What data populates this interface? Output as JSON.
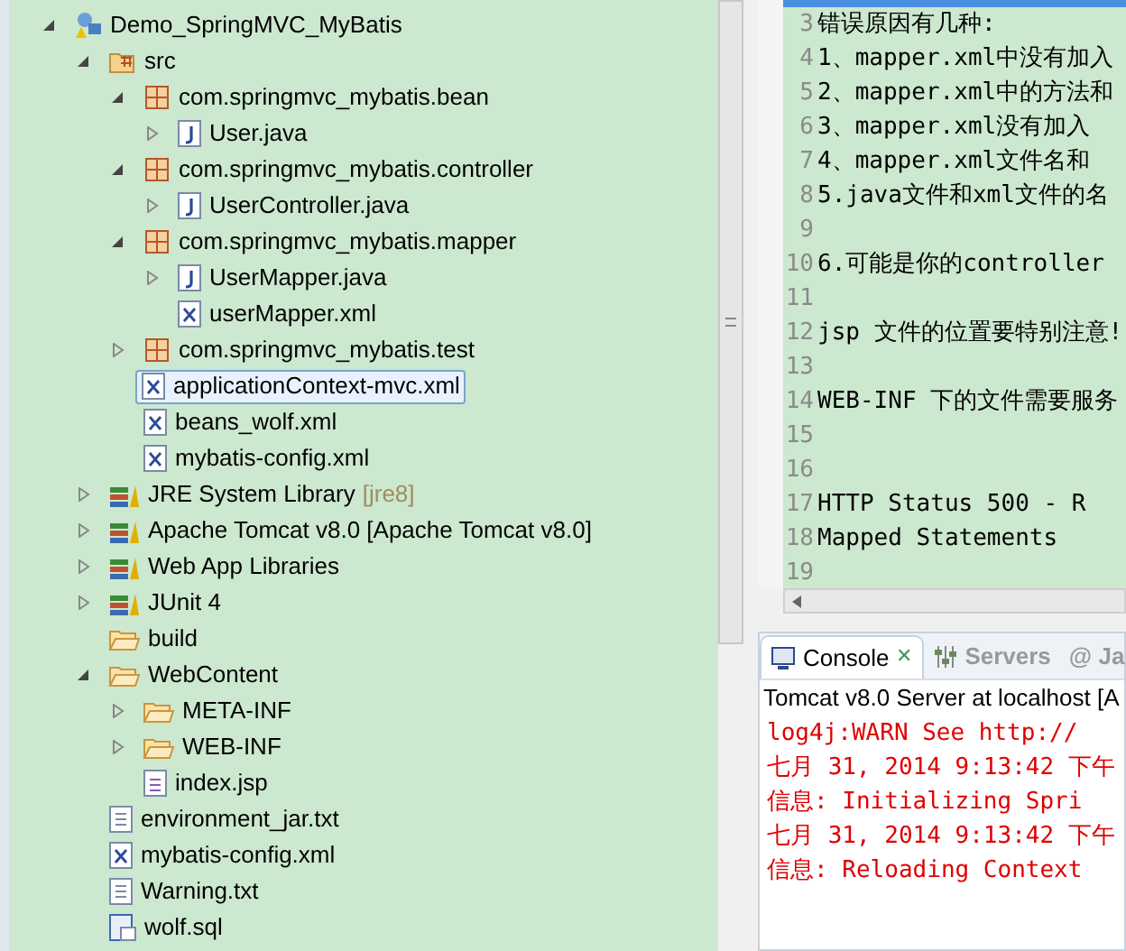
{
  "tree": [
    {
      "label": "Demo_SpringMVC_MyBatis",
      "kind": "project",
      "expanded": true,
      "selected": false,
      "children": [
        {
          "label": "src",
          "kind": "source-folder",
          "expanded": true,
          "selected": false,
          "children": [
            {
              "label": "com.springmvc_mybatis.bean",
              "kind": "package",
              "expanded": true,
              "selected": false,
              "children": [
                {
                  "label": "User.java",
                  "kind": "java",
                  "expanded": false,
                  "selected": false
                }
              ]
            },
            {
              "label": "com.springmvc_mybatis.controller",
              "kind": "package",
              "expanded": true,
              "selected": false,
              "children": [
                {
                  "label": "UserController.java",
                  "kind": "java",
                  "expanded": false,
                  "selected": false
                }
              ]
            },
            {
              "label": "com.springmvc_mybatis.mapper",
              "kind": "package",
              "expanded": true,
              "selected": false,
              "children": [
                {
                  "label": "UserMapper.java",
                  "kind": "java",
                  "expanded": false,
                  "selected": false
                },
                {
                  "label": "userMapper.xml",
                  "kind": "xml",
                  "selected": false
                }
              ]
            },
            {
              "label": "com.springmvc_mybatis.test",
              "kind": "package",
              "expanded": false,
              "selected": false
            },
            {
              "label": "applicationContext-mvc.xml",
              "kind": "xml",
              "selected": true
            },
            {
              "label": "beans_wolf.xml",
              "kind": "xml",
              "selected": false
            },
            {
              "label": "mybatis-config.xml",
              "kind": "xml",
              "selected": false
            }
          ]
        },
        {
          "label": "JRE System Library",
          "decoration": "[jre8]",
          "kind": "library",
          "expanded": false,
          "selected": false
        },
        {
          "label": "Apache Tomcat v8.0 [Apache Tomcat v8.0]",
          "kind": "library",
          "expanded": false,
          "selected": false
        },
        {
          "label": "Web App Libraries",
          "kind": "library",
          "expanded": false,
          "selected": false
        },
        {
          "label": "JUnit 4",
          "kind": "library",
          "expanded": false,
          "selected": false
        },
        {
          "label": "build",
          "kind": "folder",
          "selected": false
        },
        {
          "label": "WebContent",
          "kind": "folder",
          "expanded": true,
          "selected": false,
          "children": [
            {
              "label": "META-INF",
              "kind": "folder",
              "expanded": false,
              "selected": false
            },
            {
              "label": "WEB-INF",
              "kind": "folder",
              "expanded": false,
              "selected": false
            },
            {
              "label": "index.jsp",
              "kind": "jsp",
              "selected": false
            }
          ]
        },
        {
          "label": "environment_jar.txt",
          "kind": "text",
          "selected": false
        },
        {
          "label": "mybatis-config.xml",
          "kind": "xml",
          "selected": false
        },
        {
          "label": "Warning.txt",
          "kind": "text",
          "selected": false
        },
        {
          "label": "wolf.sql",
          "kind": "sql",
          "selected": false
        }
      ]
    }
  ],
  "editor": {
    "lines": [
      {
        "number": "3",
        "text": "错误原因有几种:"
      },
      {
        "number": "4",
        "text": "1、mapper.xml中没有加入"
      },
      {
        "number": "5",
        "text": "2、mapper.xml中的方法和"
      },
      {
        "number": "6",
        "text": "3、mapper.xml没有加入"
      },
      {
        "number": "7",
        "text": "4、mapper.xml文件名和"
      },
      {
        "number": "8",
        "text": "5.java文件和xml文件的名"
      },
      {
        "number": "9"
      },
      {
        "number": "10",
        "text": "6.可能是你的controller"
      },
      {
        "number": "11"
      },
      {
        "number": "12",
        "text": "jsp 文件的位置要特别注意!"
      },
      {
        "number": "13"
      },
      {
        "number": "14",
        "text": "WEB-INF 下的文件需要服务"
      },
      {
        "number": "15"
      },
      {
        "number": "16"
      },
      {
        "number": "17",
        "text": "HTTP Status 500 - R"
      },
      {
        "number": "18",
        "text": "Mapped Statements"
      },
      {
        "number": "19"
      }
    ]
  },
  "console": {
    "tabs": [
      {
        "label": "Console",
        "kind": "console",
        "selected": true,
        "close": "✕"
      },
      {
        "label": "Servers",
        "kind": "servers",
        "selected": false
      },
      {
        "label": "@ Ja",
        "kind": "plain",
        "selected": false
      }
    ],
    "title": "Tomcat v8.0 Server at localhost [A",
    "lines": [
      "log4j:WARN See http://",
      "七月 31, 2014 9:13:42 下午",
      "信息: Initializing Spri",
      "七月 31, 2014 9:13:42 下午",
      "信息: Reloading Context"
    ]
  }
}
